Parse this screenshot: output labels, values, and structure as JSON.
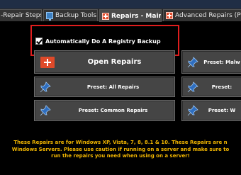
{
  "window": {
    "title": ""
  },
  "tabs": [
    {
      "label": "-Repair Steps",
      "icon": "none",
      "active": false
    },
    {
      "label": "Backup Tools",
      "icon": "computer-icon",
      "active": false
    },
    {
      "label": "Repairs - Main",
      "icon": "plus-icon",
      "active": true
    },
    {
      "label": "Advanced Repairs (Pro",
      "icon": "plus-icon",
      "active": false
    }
  ],
  "options": {
    "registry_backup_label": "Automatically Do A Registry Backup",
    "registry_backup_checked": true
  },
  "buttons": {
    "open_repairs": "Open Repairs",
    "preset_malware": "Preset: Malw",
    "preset_all_repairs": "Preset: All Repairs",
    "preset_right_2": "Preset:",
    "preset_common_repairs": "Preset: Common Repairs",
    "preset_right_3": "Preset: W"
  },
  "notice": {
    "line1": "These Repairs are for Windows XP, Vista, 7, 8, 8.1 & 10. These Repairs are n",
    "line2": "Windows Servers. Please use caution if running on a server and make sure to",
    "line3": "run the repairs you need when using on a server!"
  },
  "colors": {
    "accent_red": "#e01d1d",
    "notice_yellow": "#f2b600",
    "button_bg": "#454545",
    "pin_blue": "#2e6ec0"
  }
}
